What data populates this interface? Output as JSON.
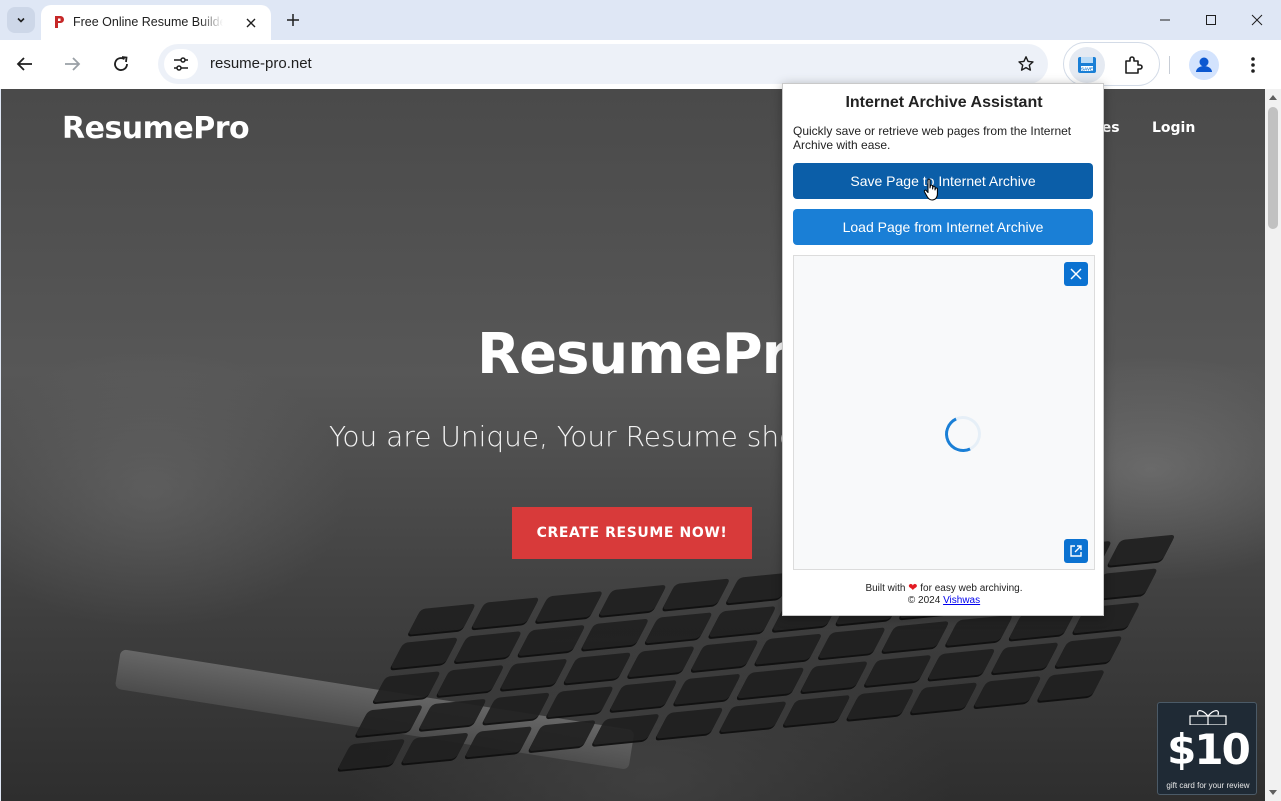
{
  "browser": {
    "tab": {
      "title": "Free Online Resume Builder | ResumePro"
    },
    "address_bar": {
      "url": "resume-pro.net"
    },
    "icons": {
      "tab_search": "chevron-down-icon",
      "tab_close": "close-icon",
      "new_tab": "plus-icon",
      "back": "back-arrow-icon",
      "forward": "forward-arrow-icon",
      "reload": "reload-icon",
      "site_info": "tune-icon",
      "bookmark": "star-icon",
      "extension": "internet-archive-save-icon",
      "extensions_menu": "puzzle-icon",
      "profile": "avatar-icon",
      "menu": "kebab-menu-icon"
    }
  },
  "page": {
    "brand": "ResumePro",
    "nav": {
      "templates_partial": "tes",
      "login": "Login"
    },
    "hero": {
      "title": "ResumePro",
      "subtitle": "You are Unique, Your Resume sho",
      "cta": "CREATE RESUME NOW!"
    },
    "gift_card": {
      "amount": "$10",
      "caption": "gift card for your review"
    },
    "colors": {
      "cta": "#d83a3a"
    }
  },
  "popup": {
    "title": "Internet Archive Assistant",
    "description": "Quickly save or retrieve web pages from the Internet Archive with ease.",
    "save_button": "Save Page to Internet Archive",
    "load_button": "Load Page from Internet Archive",
    "footer": {
      "built_prefix": "Built with",
      "built_suffix": "for easy web archiving.",
      "copyright": "© 2024",
      "author": "Vishwas"
    },
    "colors": {
      "save": "#0b5ea8",
      "load": "#1a7fd6"
    }
  }
}
